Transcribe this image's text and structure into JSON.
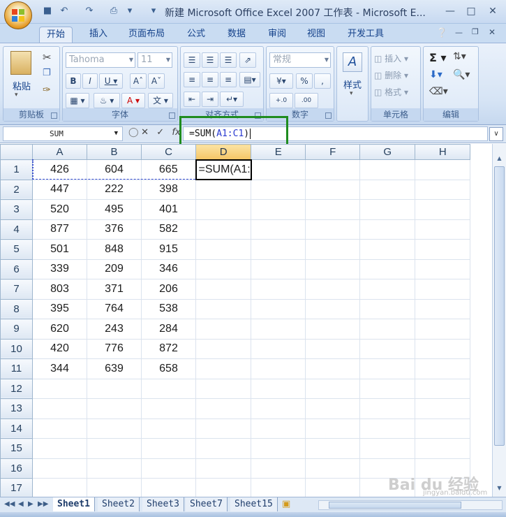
{
  "window": {
    "title": "新建 Microsoft Office Excel 2007 工作表 - Microsoft E...",
    "controls": [
      "minimize-icon",
      "maximize-icon",
      "close-icon"
    ]
  },
  "quick_access": [
    "save-icon",
    "undo-icon",
    "redo-icon",
    "print-preview-icon",
    "customize-icon"
  ],
  "tabs": [
    {
      "label": "开始",
      "active": true
    },
    {
      "label": "插入"
    },
    {
      "label": "页面布局"
    },
    {
      "label": "公式"
    },
    {
      "label": "数据"
    },
    {
      "label": "审阅"
    },
    {
      "label": "视图"
    },
    {
      "label": "开发工具"
    }
  ],
  "ribbon": {
    "clipboard": {
      "label": "剪贴板",
      "paste": "粘贴"
    },
    "font": {
      "label": "字体",
      "font_name": "Tahoma",
      "font_size": "11"
    },
    "alignment": {
      "label": "对齐方式"
    },
    "number": {
      "label": "数字",
      "format": "常规"
    },
    "styles": {
      "label": "样式"
    },
    "cells": {
      "label": "单元格",
      "insert": "插入",
      "delete": "删除",
      "format": "格式"
    },
    "editing": {
      "label": "编辑"
    }
  },
  "formula_bar": {
    "name_box": "SUM",
    "formula_prefix": "=SUM(",
    "formula_ref": "A1:C1",
    "formula_suffix": ")"
  },
  "sheet": {
    "columns": [
      "A",
      "B",
      "C",
      "D",
      "E",
      "F",
      "G",
      "H"
    ],
    "active_column": "D",
    "rows": [
      {
        "n": "1",
        "a": "426",
        "b": "604",
        "c": "665",
        "d": "=SUM(A1:"
      },
      {
        "n": "2",
        "a": "447",
        "b": "222",
        "c": "398"
      },
      {
        "n": "3",
        "a": "520",
        "b": "495",
        "c": "401"
      },
      {
        "n": "4",
        "a": "877",
        "b": "376",
        "c": "582"
      },
      {
        "n": "5",
        "a": "501",
        "b": "848",
        "c": "915"
      },
      {
        "n": "6",
        "a": "339",
        "b": "209",
        "c": "346"
      },
      {
        "n": "7",
        "a": "803",
        "b": "371",
        "c": "206"
      },
      {
        "n": "8",
        "a": "395",
        "b": "764",
        "c": "538"
      },
      {
        "n": "9",
        "a": "620",
        "b": "243",
        "c": "284"
      },
      {
        "n": "10",
        "a": "420",
        "b": "776",
        "c": "872"
      },
      {
        "n": "11",
        "a": "344",
        "b": "639",
        "c": "658"
      },
      {
        "n": "12"
      },
      {
        "n": "13"
      },
      {
        "n": "14"
      },
      {
        "n": "15"
      },
      {
        "n": "16"
      },
      {
        "n": "17"
      }
    ]
  },
  "sheet_tabs": [
    "Sheet1",
    "Sheet2",
    "Sheet3",
    "Sheet7",
    "Sheet15"
  ],
  "active_sheet": "Sheet1",
  "watermark": {
    "main": "Bai du 经验",
    "sub": "jingyan.baidu.com"
  },
  "colors": {
    "highlight_box": "#1f8c1f",
    "reference": "#2a3ad0"
  }
}
